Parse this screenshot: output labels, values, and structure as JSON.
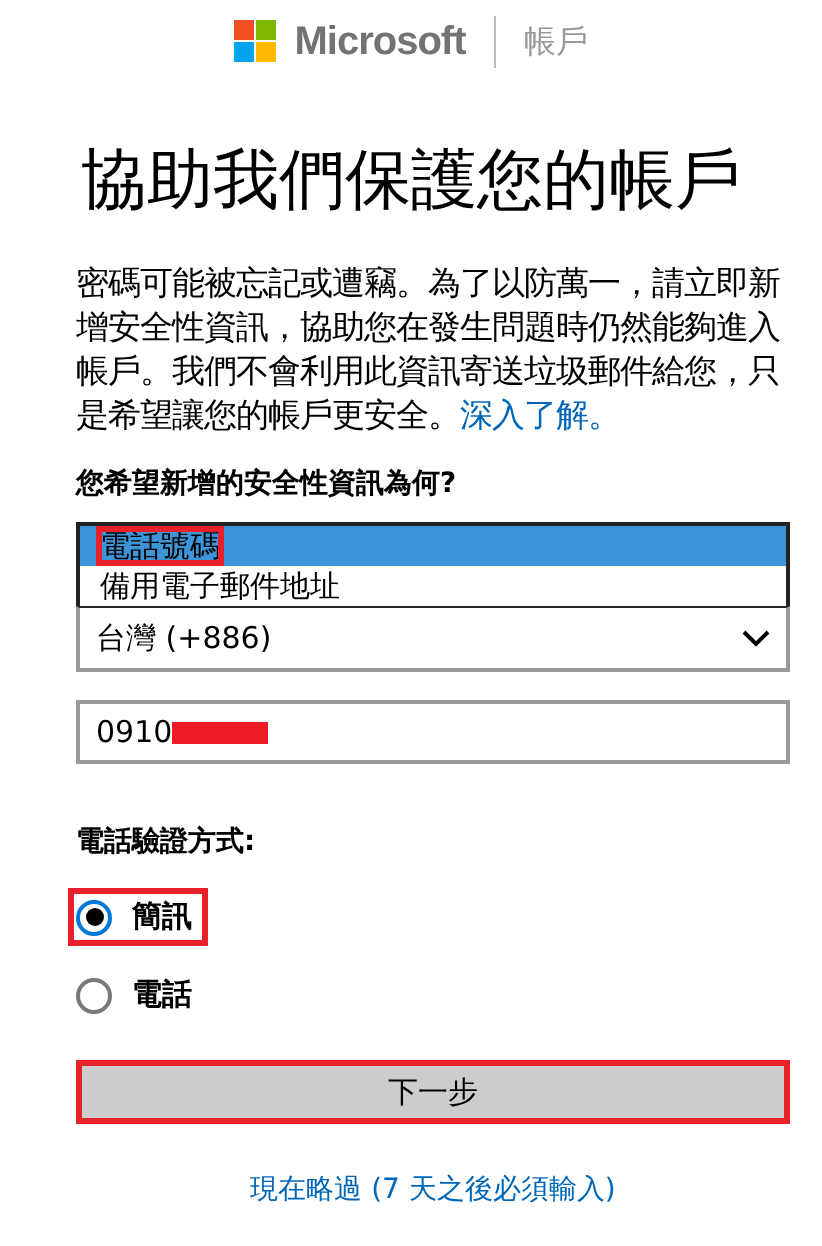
{
  "header": {
    "brand": "Microsoft",
    "section": "帳戶"
  },
  "title": "協助我們保護您的帳戶",
  "intro": {
    "text": "密碼可能被忘記或遭竊。為了以防萬一，請立即新增安全性資訊，協助您在發生問題時仍然能夠進入帳戶。我們不會利用此資訊寄送垃圾郵件給您，只是希望讓您的帳戶更安全。",
    "link": "深入了解。"
  },
  "question": "您希望新增的安全性資訊為何?",
  "dropdown_options": [
    {
      "label": "電話號碼",
      "selected": true,
      "highlighted": true
    },
    {
      "label": "備用電子郵件地址",
      "selected": false,
      "highlighted": false
    }
  ],
  "country_select": {
    "value": "台灣 (+886)"
  },
  "phone_field": {
    "value": "0910",
    "redacted": true
  },
  "method_label": "電話驗證方式:",
  "methods": [
    {
      "label": "簡訊",
      "selected": true,
      "highlighted": true
    },
    {
      "label": "電話",
      "selected": false,
      "highlighted": false
    }
  ],
  "next_button": {
    "label": "下一步",
    "highlighted": true
  },
  "skip_link": "現在略過 (7 天之後必須輸入)"
}
